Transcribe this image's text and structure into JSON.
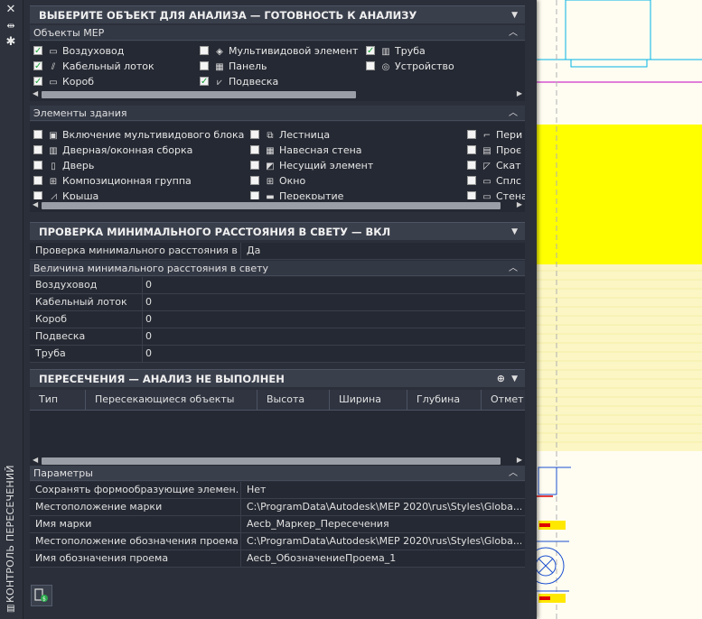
{
  "palette_title": "КОНТРОЛЬ ПЕРЕСЕЧЕНИЙ",
  "sidebar": {
    "close": "✕",
    "pin": "⇹",
    "settings": "✱"
  },
  "section1": {
    "title": "ВЫБЕРИТЕ ОБЪЕКТ ДЛЯ АНАЛИЗА — ГОТОВНОСТЬ К АНАЛИЗУ",
    "mep_header": "Объекты MEP",
    "mep_items": [
      {
        "label": "Воздуховод",
        "checked": true,
        "icon": "duct-icon"
      },
      {
        "label": "Кабельный лоток",
        "checked": true,
        "icon": "cable-tray-icon"
      },
      {
        "label": "Короб",
        "checked": true,
        "icon": "conduit-icon"
      },
      {
        "label": "Мультивидовой элемент",
        "checked": false,
        "icon": "multiview-icon"
      },
      {
        "label": "Панель",
        "checked": false,
        "icon": "panel-icon"
      },
      {
        "label": "Подвеска",
        "checked": true,
        "icon": "hanger-icon"
      },
      {
        "label": "Труба",
        "checked": true,
        "icon": "pipe-icon"
      },
      {
        "label": "Устройство",
        "checked": false,
        "icon": "device-icon"
      }
    ],
    "building_header": "Элементы здания",
    "building_items": [
      {
        "label": "Включение мультивидового блока",
        "checked": false
      },
      {
        "label": "Дверная/оконная сборка",
        "checked": false
      },
      {
        "label": "Дверь",
        "checked": false
      },
      {
        "label": "Композиционная группа",
        "checked": false
      },
      {
        "label": "Крыша",
        "checked": false
      },
      {
        "label": "Лестница",
        "checked": false
      },
      {
        "label": "Навесная стена",
        "checked": false
      },
      {
        "label": "Несущий элемент",
        "checked": false
      },
      {
        "label": "Окно",
        "checked": false
      },
      {
        "label": "Перекрытие",
        "checked": false
      },
      {
        "label": "Пери",
        "checked": false
      },
      {
        "label": "Проє",
        "checked": false
      },
      {
        "label": "Скат",
        "checked": false
      },
      {
        "label": "Сплс",
        "checked": false
      },
      {
        "label": "Стена",
        "checked": false
      }
    ]
  },
  "section2": {
    "title": "ПРОВЕРКА МИНИМАЛЬНОГО РАССТОЯНИЯ В СВЕТУ — ВКЛ",
    "check_label": "Проверка минимального расстояния в...",
    "check_value": "Да",
    "sub_header": "Величина минимального расстояния в свету",
    "rows": [
      {
        "label": "Воздуховод",
        "value": "0"
      },
      {
        "label": "Кабельный лоток",
        "value": "0"
      },
      {
        "label": "Короб",
        "value": "0"
      },
      {
        "label": "Подвеска",
        "value": "0"
      },
      {
        "label": "Труба",
        "value": "0"
      }
    ]
  },
  "section3": {
    "title": "ПЕРЕСЕЧЕНИЯ — АНАЛИЗ НЕ ВЫПОЛНЕН",
    "columns": [
      "Тип",
      "Пересекающиеся объекты",
      "Высота",
      "Ширина",
      "Глубина",
      "Отмет"
    ]
  },
  "params": {
    "header": "Параметры",
    "rows": [
      {
        "label": "Сохранять формообразующие элемен...",
        "value": "Нет"
      },
      {
        "label": "Местоположение марки",
        "value": "C:\\ProgramData\\Autodesk\\MEP 2020\\rus\\Styles\\Globa..."
      },
      {
        "label": "Имя марки",
        "value": "Aecb_Маркер_Пересечения"
      },
      {
        "label": "Местоположение обозначения проема",
        "value": "C:\\ProgramData\\Autodesk\\MEP 2020\\rus\\Styles\\Globa..."
      },
      {
        "label": "Имя обозначения проема",
        "value": "Aecb_ОбозначениеПроема_1"
      }
    ]
  },
  "colors": {
    "palette_bg": "#2b2f3a",
    "header_bg": "#3a3f4c",
    "cad_yellow": "#ffff00",
    "cad_line_cyan": "#00b4e6",
    "cad_line_magenta": "#c000c0"
  }
}
